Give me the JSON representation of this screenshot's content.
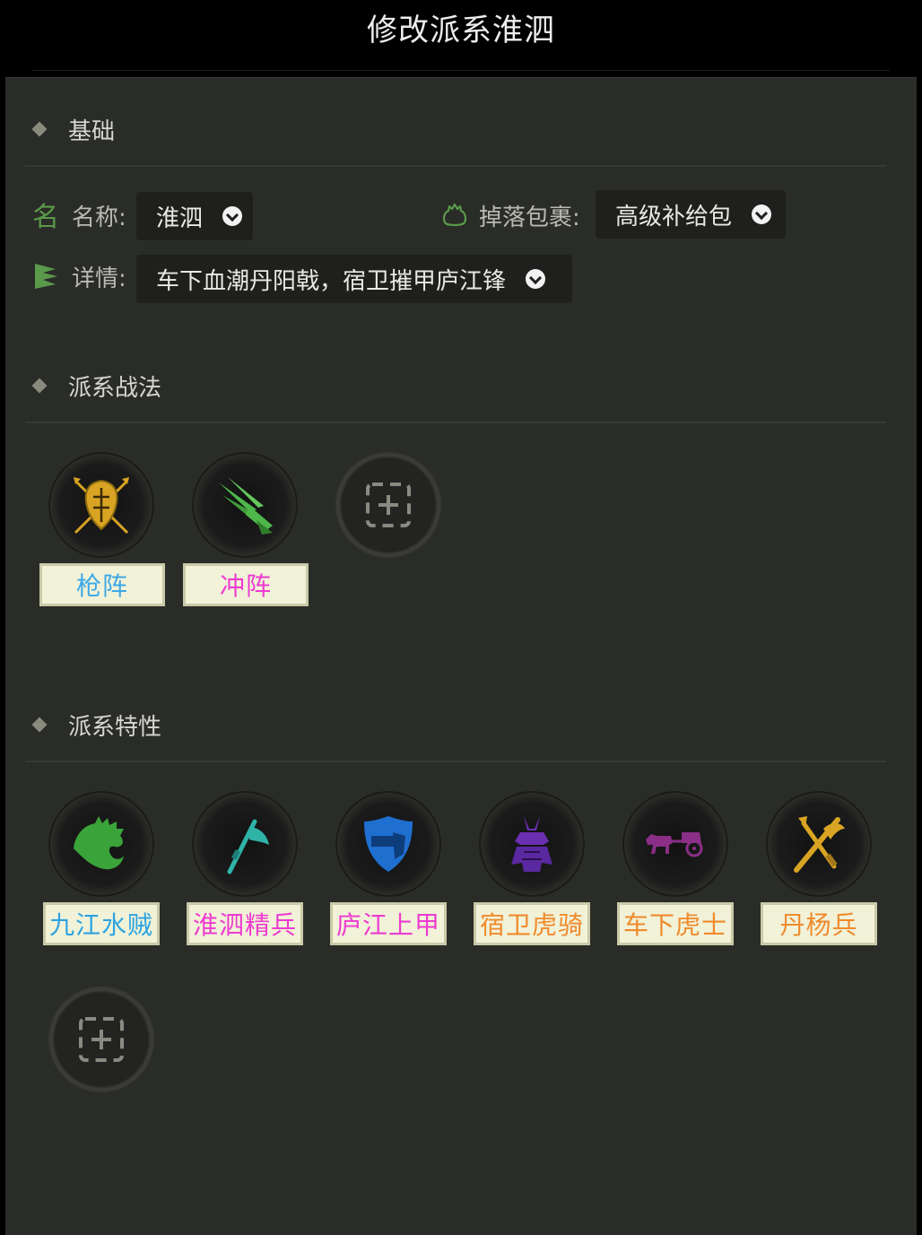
{
  "window": {
    "title": "修改派系淮泗"
  },
  "sections": {
    "basic": "基础",
    "tactics": "派系战法",
    "traits": "派系特性"
  },
  "fields": {
    "name": {
      "icon_char": "名",
      "label": "名称:",
      "value": "淮泗"
    },
    "drop": {
      "label": "掉落包裹:",
      "value": "高级补给包"
    },
    "detail": {
      "label": "详情:",
      "value": "车下血潮丹阳戟，宿卫摧甲庐江锋"
    }
  },
  "tactics": [
    {
      "name": "枪阵",
      "color": "#3fa9e6",
      "icon": "shield-spears-icon"
    },
    {
      "name": "冲阵",
      "color": "#ee3bd0",
      "icon": "charge-feather-icon"
    }
  ],
  "traits": [
    {
      "name": "九江水贼",
      "color": "#2fa3e0",
      "icon": "wave-crest-icon"
    },
    {
      "name": "淮泗精兵",
      "color": "#ee3bd0",
      "icon": "tomahawk-icon"
    },
    {
      "name": "庐江上甲",
      "color": "#ee3bd0",
      "icon": "armored-shield-icon"
    },
    {
      "name": "宿卫虎骑",
      "color": "#f08a2c",
      "icon": "samurai-armor-icon"
    },
    {
      "name": "车下虎士",
      "color": "#f08a2c",
      "icon": "horse-carriage-icon"
    },
    {
      "name": "丹杨兵",
      "color": "#f08a2c",
      "icon": "crossed-axe-icon"
    }
  ],
  "colors": {
    "panel_bg": "#2a2c28",
    "accent_green": "#5a9a4a",
    "tag_bg": "#f1f2d8"
  }
}
